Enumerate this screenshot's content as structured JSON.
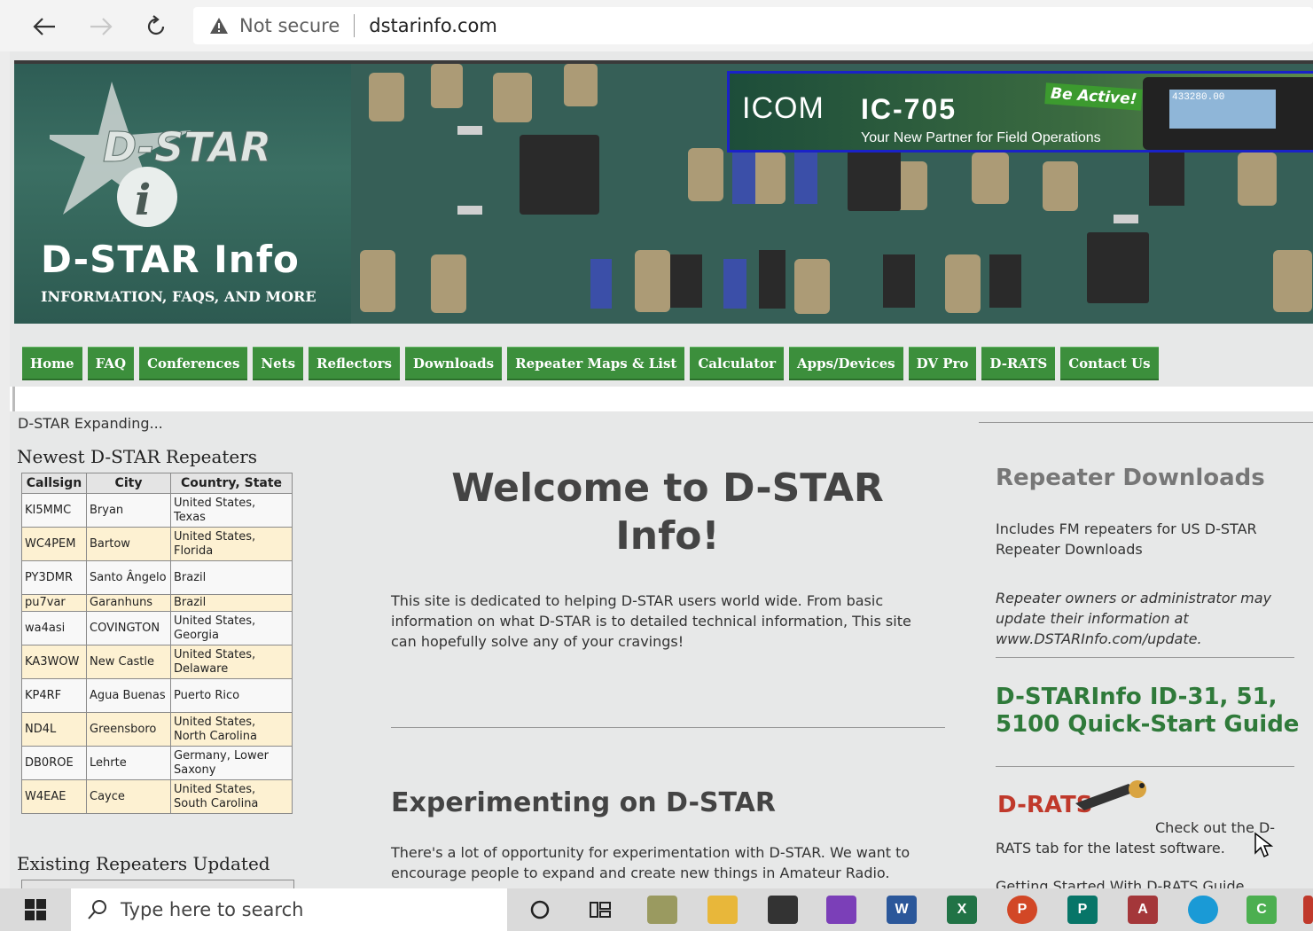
{
  "browser": {
    "security_label": "Not secure",
    "url": "dstarinfo.com"
  },
  "header": {
    "logo_title": "D-STAR Info",
    "logo_subtitle": "INFORMATION, FAQS, AND MORE",
    "ad": {
      "brand": "ICOM",
      "model": "IC-705",
      "tagline": "Your New Partner for Field Operations",
      "badge": "Be Active!",
      "display": "433280.00"
    }
  },
  "nav": {
    "tabs": [
      "Home",
      "FAQ",
      "Conferences",
      "Nets",
      "Reflectors",
      "Downloads",
      "Repeater Maps & List",
      "Calculator",
      "Apps/Devices",
      "DV Pro",
      "D-RATS",
      "Contact Us"
    ]
  },
  "status_text": "D-STAR Expanding...",
  "left": {
    "newest_title": "Newest D-STAR Repeaters",
    "columns": [
      "Callsign",
      "City",
      "Country, State"
    ],
    "rows": [
      [
        "KI5MMC",
        "Bryan",
        "United States, Texas"
      ],
      [
        "WC4PEM",
        "Bartow",
        "United States, Florida"
      ],
      [
        "PY3DMR",
        "Santo Ângelo",
        "Brazil"
      ],
      [
        "pu7var",
        "Garanhuns",
        "Brazil"
      ],
      [
        "wa4asi",
        "COVINGTON",
        "United States, Georgia"
      ],
      [
        "KA3WOW",
        "New Castle",
        "United States, Delaware"
      ],
      [
        "KP4RF",
        "Agua Buenas",
        "Puerto Rico"
      ],
      [
        "ND4L",
        "Greensboro",
        "United States, North Carolina"
      ],
      [
        "DB0ROE",
        "Lehrte",
        "Germany, Lower Saxony"
      ],
      [
        "W4EAE",
        "Cayce",
        "United States, South Carolina"
      ]
    ],
    "updated_title": "Existing Repeaters Updated"
  },
  "center": {
    "welcome": "Welcome to D-STAR Info!",
    "intro": "This site is dedicated to helping D-STAR users world wide. From basic information on what D-STAR is to detailed technical information, This site can hopefully solve any of your cravings!",
    "exp_title": "Experimenting on D-STAR",
    "exp_text": "There's a lot of opportunity for experimentation with D-STAR. We want to encourage people to expand and create new things in Amateur Radio."
  },
  "right": {
    "rd_title": "Repeater Downloads",
    "rd_text": "Includes FM repeaters for US D-STAR Repeater Downloads",
    "rd_italic": "Repeater owners or administrator may update their information at www.DSTARInfo.com/update.",
    "qs_title": "D-STARInfo ID-31, 51, 5100 Quick-Start Guide",
    "drats_logo": "D-RATS",
    "drats_text": "Check out the D-RATS tab for the latest software.",
    "drats_more": "Getting Started With D-RATS Guide"
  },
  "taskbar": {
    "search_placeholder": "Type here to search"
  },
  "colors": {
    "tab_green": "#3c8f3c",
    "quickstart_green": "#2f7a3a",
    "ad_border": "#1a22c8"
  }
}
